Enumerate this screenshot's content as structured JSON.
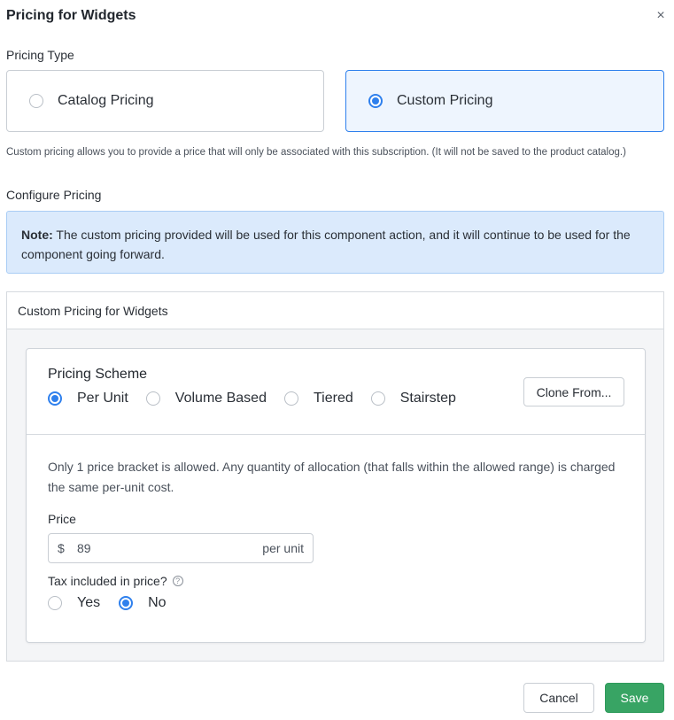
{
  "dialog": {
    "title": "Pricing for Widgets",
    "close_icon": "close-icon"
  },
  "pricing_type": {
    "label": "Pricing Type",
    "options": [
      {
        "label": "Catalog Pricing",
        "selected": false
      },
      {
        "label": "Custom Pricing",
        "selected": true
      }
    ],
    "help_text": "Custom pricing allows you to provide a price that will only be associated with this subscription. (It will not be saved to the product catalog.)"
  },
  "configure": {
    "label": "Configure Pricing",
    "note_prefix": "Note:",
    "note_text": " The custom pricing provided will be used for this component action, and it will continue to be used for the component going forward."
  },
  "panel": {
    "title": "Custom Pricing for Widgets",
    "scheme_title": "Pricing Scheme",
    "schemes": [
      {
        "label": "Per Unit",
        "selected": true
      },
      {
        "label": "Volume Based",
        "selected": false
      },
      {
        "label": "Tiered",
        "selected": false
      },
      {
        "label": "Stairstep",
        "selected": false
      }
    ],
    "clone_label": "Clone From...",
    "description": "Only 1 price bracket is allowed. Any quantity of allocation (that falls within the allowed range) is charged the same per-unit cost.",
    "price_label": "Price",
    "currency": "$",
    "price_value": "89",
    "price_unit": "per unit",
    "tax_label": "Tax included in price?",
    "tax_help_icon": "question-circle-icon",
    "tax_options": [
      {
        "label": "Yes",
        "selected": false
      },
      {
        "label": "No",
        "selected": true
      }
    ]
  },
  "footer": {
    "cancel_label": "Cancel",
    "save_label": "Save"
  },
  "colors": {
    "accent": "#2f80ed",
    "save": "#38a464",
    "note_bg": "#dbeafc"
  }
}
